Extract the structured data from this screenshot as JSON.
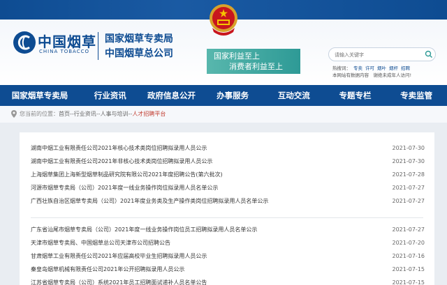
{
  "header": {
    "logo_cn": "中国烟草",
    "logo_en": "CHINA TOBACCO",
    "org_line1": "国家烟草专卖局",
    "org_line2": "中国烟草总公司",
    "slogan_line1": "国家利益至上",
    "slogan_line2": "消费者利益至上"
  },
  "search": {
    "placeholder": "请输入关键字",
    "hot_label": "热搜词：",
    "hot_words": [
      "专卖",
      "许可",
      "烟叶",
      "烟杆",
      "招聘"
    ],
    "visit_text": "本网站有数据内容　谢绝未成年人访问!"
  },
  "nav": {
    "items": [
      "国家烟草专卖局",
      "行业资讯",
      "政府信息公开",
      "办事服务",
      "互动交流",
      "专题专栏",
      "专卖监管"
    ]
  },
  "breadcrumb": {
    "prefix": "您当前的位置：",
    "path": "首页--行业资讯--人事与培训--",
    "current": "人才招聘平台"
  },
  "news": {
    "group1": [
      {
        "title": "湖南中烟工业有限责任公司2021年核心技术类岗位招聘拟录用人员公示",
        "date": "2021-07-30"
      },
      {
        "title": "湖南中烟工业有限责任公司2021年非核心技术类岗位招聘拟录用人员公示",
        "date": "2021-07-30"
      },
      {
        "title": "上海烟草集团上海新型烟草制品研究院有限公司2021年度招聘公告(第六批次)",
        "date": "2021-07-28"
      },
      {
        "title": "河源市烟草专卖局（公司）2021年度一线业务操作岗位拟录用人员名单公示",
        "date": "2021-07-27"
      },
      {
        "title": "广西壮族自治区烟草专卖局（公司）2021年度业务类及生产操作类岗位招聘拟录用人员名单公示",
        "date": "2021-07-27"
      }
    ],
    "group2": [
      {
        "title": "广东省汕尾市烟草专卖局（公司）2021年度一线业务操作岗位员工招聘拟录用人员名单公示",
        "date": "2021-07-27"
      },
      {
        "title": "天津市烟草专卖局、中国烟草总公司天津市公司招聘公告",
        "date": "2021-07-20"
      },
      {
        "title": "甘肃烟草工业有限责任公司2021年应届高校毕业生招聘拟录用人员公示",
        "date": "2021-07-16"
      },
      {
        "title": "秦皇岛烟草机械有限责任公司2021年公开招聘拟录用人员公示",
        "date": "2021-07-15"
      },
      {
        "title": "江苏省烟草专卖局（公司）系统2021年员工招聘面试递补人员名单公告",
        "date": "2021-07-15"
      }
    ]
  },
  "colors": {
    "brand_blue": "#0e4c92",
    "slogan_teal": "#2e9a96",
    "crumb_red": "#c0392b"
  }
}
